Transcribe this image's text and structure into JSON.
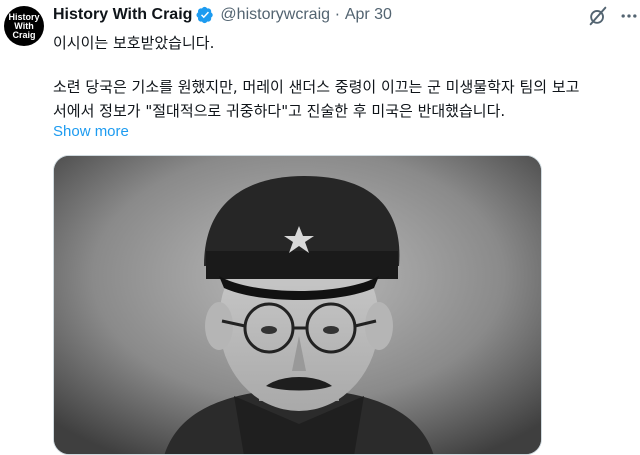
{
  "avatar": {
    "line1": "History",
    "line2": "With",
    "line3": "Craig"
  },
  "author": {
    "name": "History With Craig",
    "handle": "@historywcraig",
    "separator": "·",
    "date": "Apr 30"
  },
  "tweet": {
    "line1": "이시이는 보호받았습니다.",
    "line2": "소련 당국은 기소를 원했지만, 머레이 샌더스 중령이 이끄는 군 미생물학자 팀의 보고",
    "line3": "서에서 정보가 \"절대적으로 귀중하다\"고 진술한 후 미국은 반대했습니다.",
    "show_more": "Show more"
  },
  "icons": {
    "verified": "verified-badge-icon",
    "grok": "grok-icon",
    "more": "more-horizontal-icon"
  },
  "colors": {
    "accent": "#1d9bf0",
    "secondary_text": "#536471"
  }
}
